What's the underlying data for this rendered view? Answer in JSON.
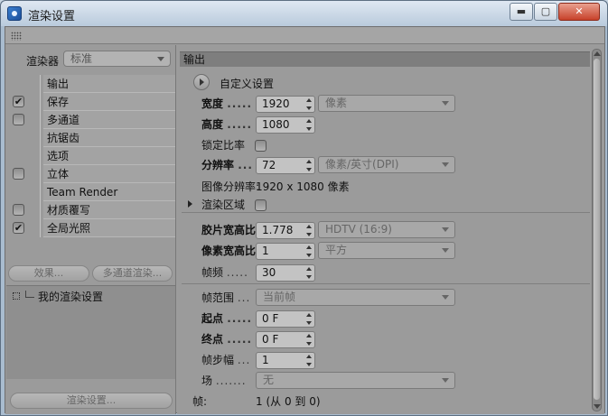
{
  "window": {
    "title": "渲染设置",
    "controls": {
      "minimize": "▬",
      "maximize": "▢",
      "close": "✕"
    }
  },
  "left": {
    "renderer_label": "渲染器",
    "renderer_value": "标准",
    "items": [
      {
        "label": "输出",
        "checkbox": false,
        "checked": false
      },
      {
        "label": "保存",
        "checkbox": true,
        "checked": true
      },
      {
        "label": "多通道",
        "checkbox": true,
        "checked": false
      },
      {
        "label": "抗锯齿",
        "checkbox": false,
        "checked": false
      },
      {
        "label": "选项",
        "checkbox": false,
        "checked": false
      },
      {
        "label": "立体",
        "checkbox": true,
        "checked": false
      },
      {
        "label": "Team Render",
        "checkbox": false,
        "checked": false
      },
      {
        "label": "材质覆写",
        "checkbox": true,
        "checked": false
      },
      {
        "label": "全局光照",
        "checkbox": true,
        "checked": true
      }
    ],
    "effects_button": "效果...",
    "multipass_button": "多通道渲染...",
    "settings_name": "我的渲染设置",
    "render_settings_button": "渲染设置..."
  },
  "right": {
    "section_title": "输出",
    "preset_label": "自定义设置",
    "width": {
      "label": "宽度",
      "value": "1920",
      "unit": "像素"
    },
    "height": {
      "label": "高度",
      "value": "1080"
    },
    "lock_ratio": {
      "label": "锁定比率",
      "checked": false
    },
    "resolution": {
      "label": "分辨率",
      "value": "72",
      "unit": "像素/英寸(DPI)"
    },
    "image_resolution": {
      "label": "图像分辨率:",
      "value": "1920 x 1080 像素"
    },
    "render_region": {
      "label": "渲染区域",
      "checked": false
    },
    "film_aspect": {
      "label": "胶片宽高比",
      "value": "1.778",
      "preset": "HDTV (16:9)"
    },
    "pixel_aspect": {
      "label": "像素宽高比",
      "value": "1",
      "preset": "平方"
    },
    "fps": {
      "label": "帧频",
      "value": "30"
    },
    "frame_range": {
      "label": "帧范围",
      "value": "当前帧"
    },
    "start": {
      "label": "起点",
      "value": "0 F"
    },
    "end": {
      "label": "终点",
      "value": "0 F"
    },
    "frame_step": {
      "label": "帧步幅",
      "value": "1"
    },
    "field": {
      "label": "场",
      "value": "无"
    },
    "frames": {
      "label": "帧:",
      "value": "1 (从 0 到 0)"
    }
  }
}
